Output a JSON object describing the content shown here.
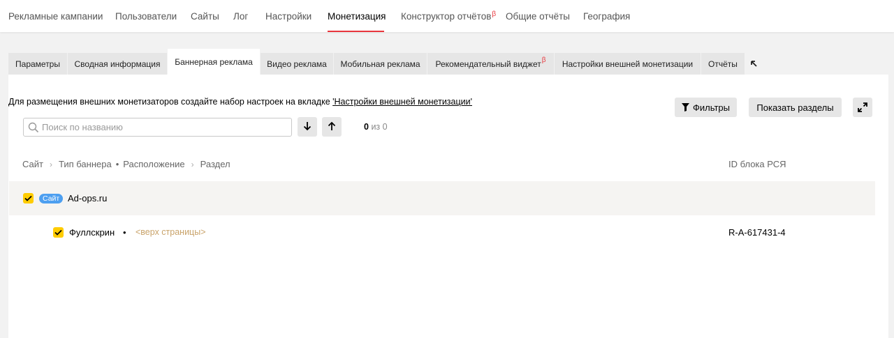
{
  "topnav": {
    "items": [
      {
        "label": "Рекламные кампании"
      },
      {
        "label": "Пользователи"
      },
      {
        "label": "Сайты"
      },
      {
        "label": "Лог"
      },
      {
        "label": "Настройки"
      },
      {
        "label": "Монетизация",
        "active": true
      },
      {
        "label": "Конструктор отчётов",
        "beta": "β"
      },
      {
        "label": "Общие отчёты"
      },
      {
        "label": "География"
      }
    ]
  },
  "tabs": {
    "items": [
      {
        "label": "Параметры"
      },
      {
        "label": "Сводная информация"
      },
      {
        "label": "Баннерная реклама",
        "active": true
      },
      {
        "label": "Видео реклама"
      },
      {
        "label": "Мобильная реклама"
      },
      {
        "label": "Рекомендательный виджет",
        "beta": "β"
      },
      {
        "label": "Настройки внешней монетизации"
      },
      {
        "label": "Отчёты"
      }
    ],
    "collapse_icon": "arrow-up-left-icon"
  },
  "content": {
    "info_text": "Для размещения внешних монетизаторов создайте набор настроек на вкладке ",
    "info_link": "'Настройки внешней монетизации'",
    "search": {
      "placeholder": "Поиск по названию",
      "value": ""
    },
    "counter": {
      "current": "0",
      "of": "из 0"
    },
    "filters_label": "Фильтры",
    "show_sections_label": "Показать разделы"
  },
  "tree": {
    "breadcrumb": {
      "site": "Сайт",
      "type": "Тип баннера",
      "position": "Расположение",
      "section": "Раздел"
    },
    "id_header": "ID блока РСЯ",
    "site_row": {
      "badge": "Сайт",
      "name": "Ad-ops.ru"
    },
    "child_row": {
      "name": "Фуллскрин",
      "dot": "•",
      "position": "<верх страницы>",
      "block_id": "R-A-617431-4"
    }
  },
  "colors": {
    "accent": "#e8363c",
    "checkbox": "#ffcc00",
    "badge": "#4d9ff0",
    "position_text": "#c9a36a"
  }
}
